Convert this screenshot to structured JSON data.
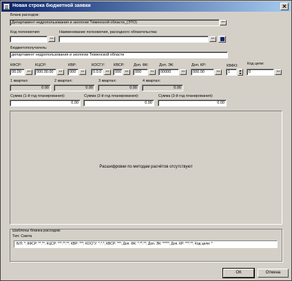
{
  "window": {
    "title": "Новая строка бюджетной заявки",
    "close_label": "✕"
  },
  "blank": {
    "label": "Бланк расходов:",
    "value": "Департамент недропользования и экологии Тюменской области_(ЭТО)"
  },
  "authority_code": {
    "label": "Код полномочия:",
    "value": ""
  },
  "authority_name": {
    "label": "Наименование полномочия, расходного обязательства:",
    "value": ""
  },
  "recipient": {
    "label": "Бюджетополучатель:",
    "value": "департамент недропользования и экологии Тюменской области"
  },
  "codes": {
    "kfsr": {
      "label": "КФСР:",
      "value": "00.00"
    },
    "kcsr": {
      "label": "КЦСР:",
      "value": "000.00.00"
    },
    "kvr": {
      "label": "КВР:",
      "value": "000"
    },
    "kosgu": {
      "label": "КОСГУ:",
      "value": "0.0.0"
    },
    "kvsr": {
      "label": "КВСР:",
      "value": "000"
    },
    "dop_fk": {
      "label": "Доп. ФК:",
      "value": "000"
    },
    "dop_ek": {
      "label": "Доп. ЭК:",
      "value": "00000"
    },
    "dop_kr": {
      "label": "Доп. КР:",
      "value": "000.00"
    },
    "kvfo": {
      "label": "КВФО:",
      "value": "1"
    },
    "target": {
      "label": "Код цели:",
      "value": "0"
    }
  },
  "quarters": [
    {
      "label": "1 квартал:",
      "value": "0.00"
    },
    {
      "label": "2 квартал:",
      "value": "0.00"
    },
    {
      "label": "3 квартал:",
      "value": "0.00"
    },
    {
      "label": "4 квартал:",
      "value": "0.00"
    }
  ],
  "sums": [
    {
      "label": "Сумма (1-й год планирования):",
      "value": "0.00"
    },
    {
      "label": "Сумма (2-й год планирования):",
      "value": "0.00"
    },
    {
      "label": "Сумма (3-й год планирования):",
      "value": "0.00"
    }
  ],
  "decryption_panel": {
    "message": "Расшифровки по методам расчётов отсутствуют"
  },
  "templates": {
    "label": "Шаблоны бланка расходов:",
    "type_label": "Тип: Смета",
    "value": "Б/Л: *; КФСР: **.**; КЦСР: ***.**.**; КВР: ***; КОСГУ: *.*.*; КВСР: ***; Доп. ФК: *.**.**; Доп. ЭК: *****; Доп. КР: ***.**; Код цели: *"
  },
  "buttons": {
    "ok": "ОК",
    "cancel": "Отмена"
  },
  "ellipsis": "..."
}
